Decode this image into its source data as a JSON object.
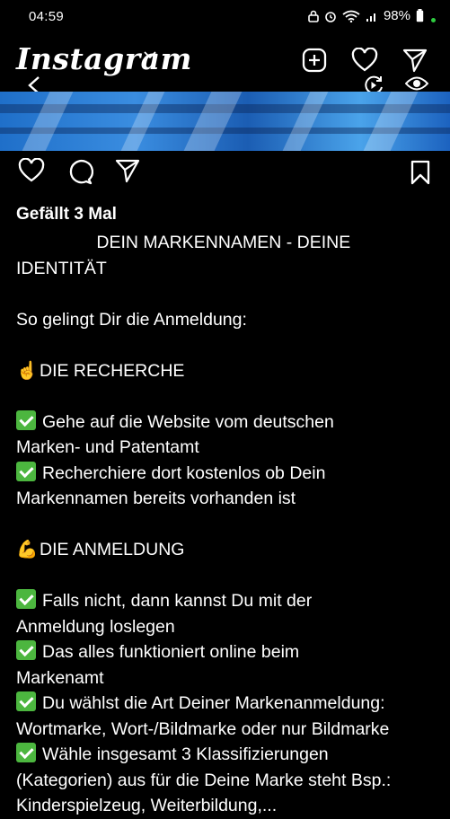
{
  "status": {
    "time": "04:59",
    "battery": "98%"
  },
  "header": {
    "app_name": "Instagram"
  },
  "post": {
    "likes": "Gefällt 3 Mal",
    "caption_title_1": "DEIN MARKENNAMEN - DEINE",
    "caption_title_2": "IDENTITÄT",
    "intro": "So gelingt Dir die Anmeldung:",
    "section1_emoji": "☝️",
    "section1": "DIE RECHERCHE",
    "s1_item1_a": "Gehe auf die Website vom deutschen",
    "s1_item1_b": "Marken- und Patentamt",
    "s1_item2_a": "Recherchiere dort kostenlos ob Dein",
    "s1_item2_b": "Markennamen bereits vorhanden ist",
    "section2_emoji": "💪",
    "section2": "DIE ANMELDUNG",
    "s2_item1_a": "Falls nicht, dann kannst Du mit der",
    "s2_item1_b": "Anmeldung loslegen",
    "s2_item2_a": "Das alles funktioniert online beim",
    "s2_item2_b": "Markenamt",
    "s2_item3_a": "Du wählst die Art Deiner Markenanmeldung:",
    "s2_item3_b": "Wortmarke, Wort-/Bildmarke oder nur Bildmarke",
    "s2_item4_a": "Wähle insgesamt 3 Klassifizierungen",
    "s2_item4_b": "(Kategorien) aus für die Deine Marke steht Bsp.:",
    "s2_item4_c": "Kinderspielzeug, Weiterbildung,..."
  }
}
